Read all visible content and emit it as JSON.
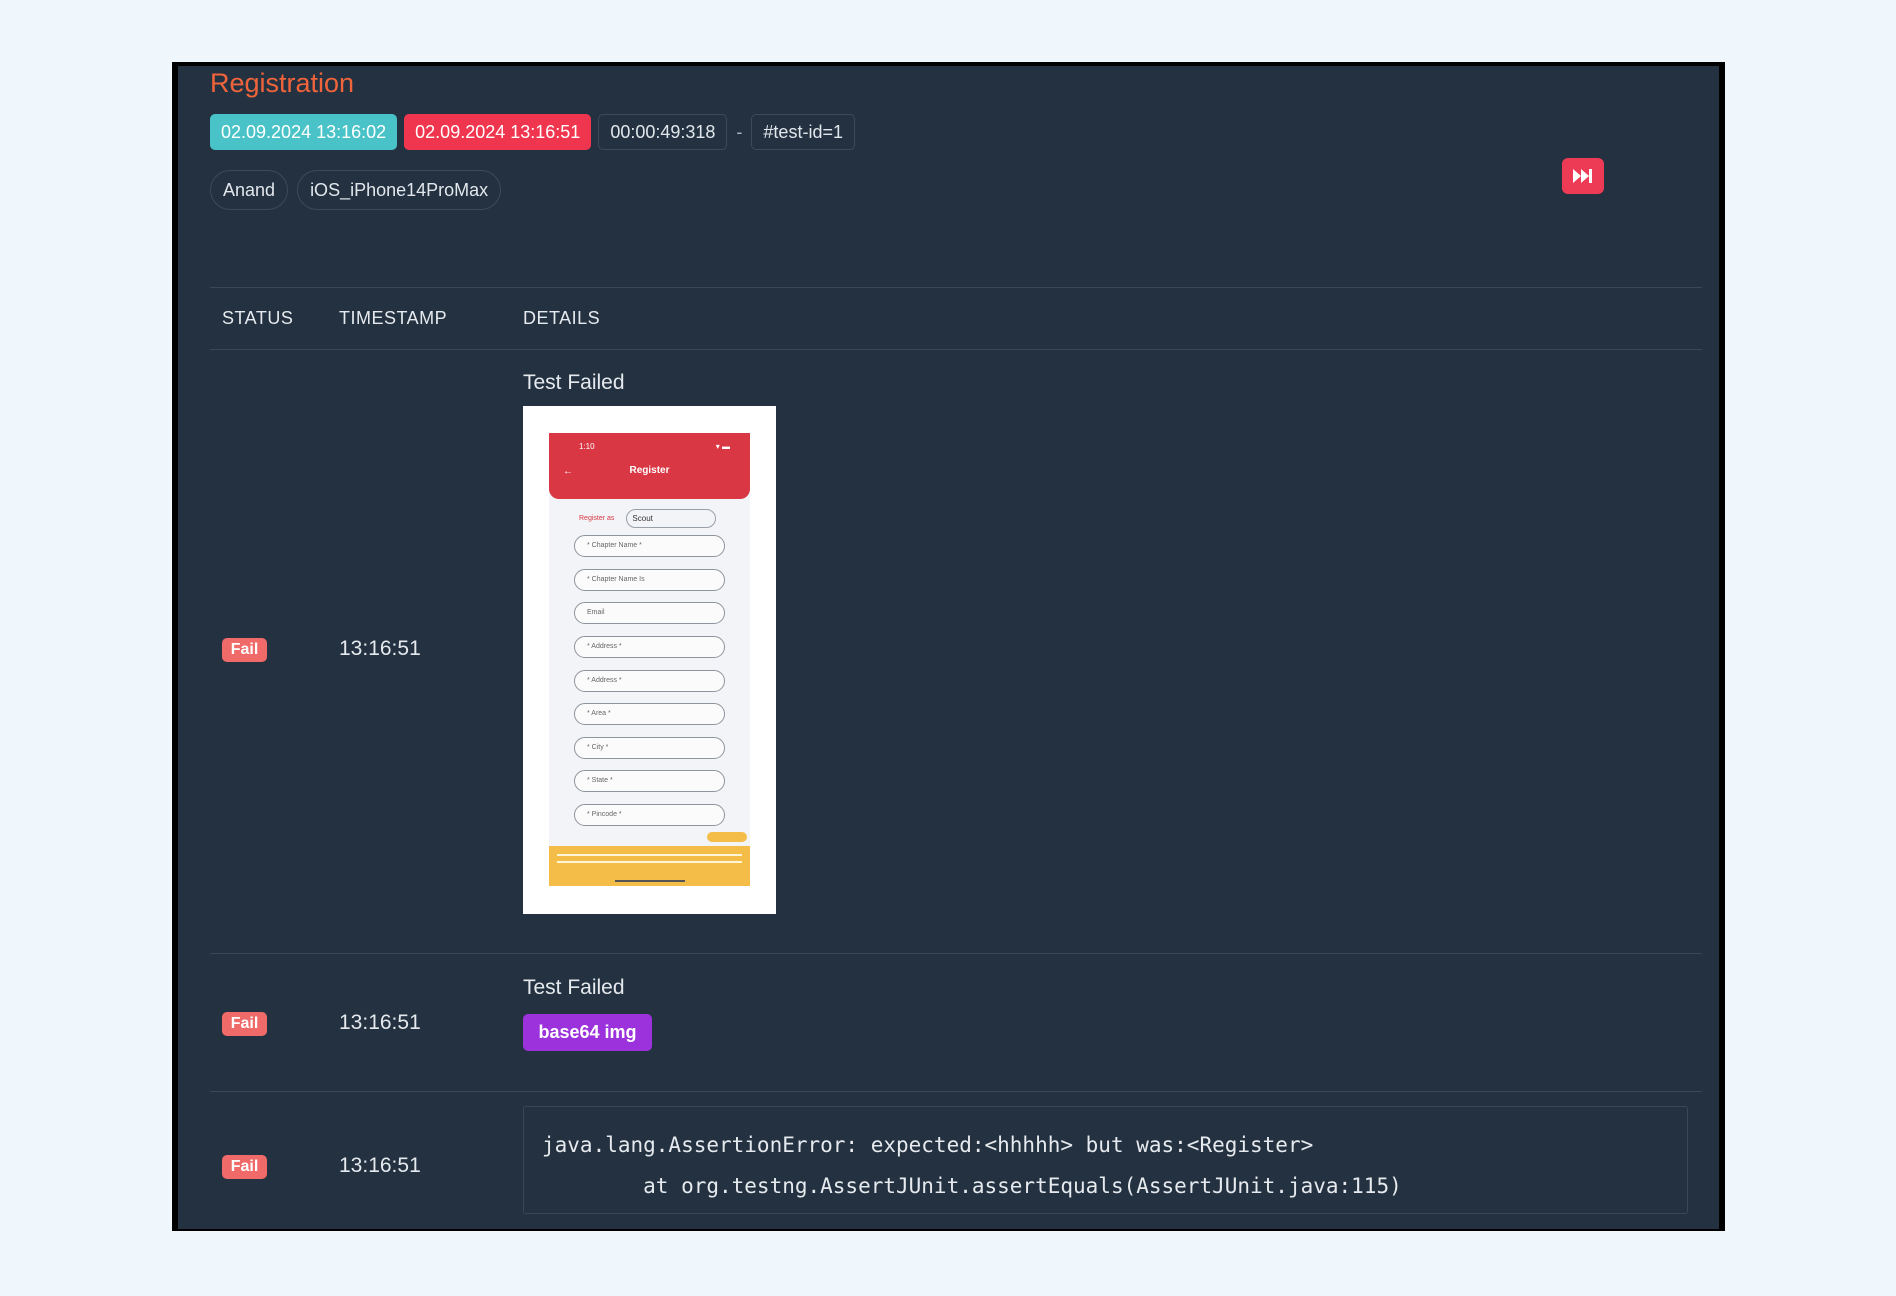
{
  "test": {
    "title": "Registration",
    "start_time": "02.09.2024 13:16:02",
    "end_time": "02.09.2024 13:16:51",
    "duration": "00:00:49:318",
    "separator": "-",
    "test_id": "#test-id=1",
    "author": "Anand",
    "device": "iOS_iPhone14ProMax"
  },
  "colors": {
    "title": "#f0643c",
    "start_chip": "#49c3c8",
    "end_chip": "#f0364f",
    "fail_badge": "#ef6a69",
    "base64_button": "#9c32dc",
    "panel_bg": "#233140"
  },
  "controls": {
    "skip_icon": "fast-forward-icon"
  },
  "table": {
    "headers": {
      "status": "STATUS",
      "timestamp": "TIMESTAMP",
      "details": "DETAILS"
    },
    "rows": [
      {
        "status": "Fail",
        "timestamp": "13:16:51",
        "details": "Test Failed",
        "attachment": "screenshot"
      },
      {
        "status": "Fail",
        "timestamp": "13:16:51",
        "details": "Test Failed",
        "attachment_label": "base64 img"
      },
      {
        "status": "Fail",
        "timestamp": "13:16:51",
        "trace_lines": [
          "java.lang.AssertionError: expected:<hhhhh> but was:<Register>",
          "        at org.testng.AssertJUnit.assertEquals(AssertJUnit.java:115)"
        ]
      }
    ]
  },
  "screenshot": {
    "status_time": "1:10",
    "status_icons": "▾ ▬",
    "back": "←",
    "header_title": "Register",
    "register_label": "Register as",
    "register_value": "Scout",
    "fields": [
      "* Chapter Name *",
      "* Chapter Name Is",
      "Email",
      "* Address *",
      "* Address *",
      "* Area *",
      "* City *",
      "* State *",
      "* Pincode *"
    ]
  }
}
